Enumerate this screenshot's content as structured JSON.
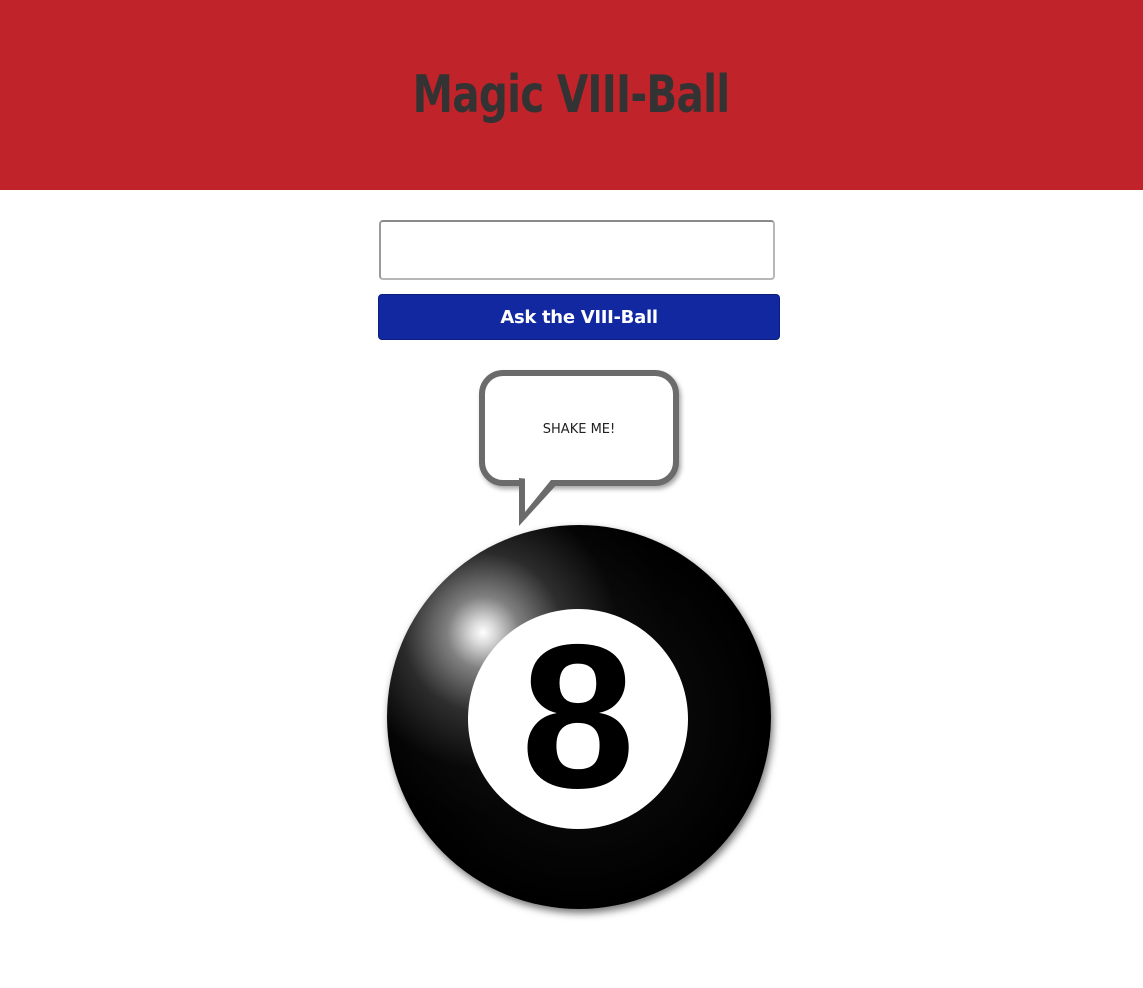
{
  "header": {
    "title": "Magic VIII-Ball"
  },
  "form": {
    "question_value": "",
    "question_placeholder": "",
    "ask_label": "Ask the VIII-Ball"
  },
  "bubble": {
    "message": "SHAKE ME!"
  },
  "ball": {
    "number": "8"
  },
  "colors": {
    "header_bg": "#c0232a",
    "title_text": "#333333",
    "button_bg": "#1228a0",
    "bubble_border": "#6b6b6b"
  }
}
